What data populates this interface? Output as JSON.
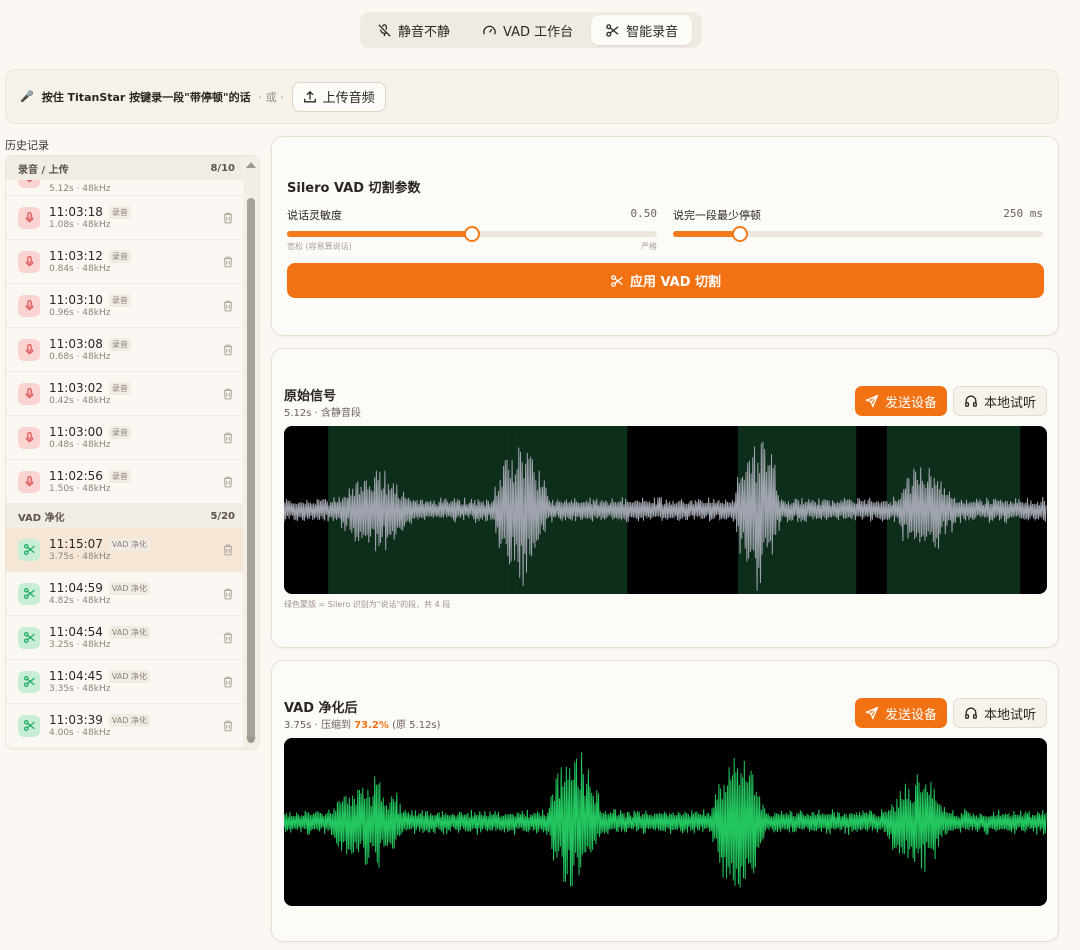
{
  "tabs": [
    {
      "label": "静音不静",
      "icon": "mic-off-icon"
    },
    {
      "label": "VAD 工作台",
      "icon": "gauge-icon"
    },
    {
      "label": "智能录音",
      "icon": "scissors-icon",
      "active": true
    }
  ],
  "hint": {
    "text": "按住 TitanStar 按键录一段\"带停顿\"的话",
    "or": "· 或 ·",
    "upload_label": "上传音频"
  },
  "history": {
    "title": "历史记录",
    "groups": [
      {
        "name": "录音 / 上传",
        "count": "8/10",
        "partial_sub": "5.12s · 48kHz",
        "items": [
          {
            "time": "11:03:18",
            "tag": "录音",
            "sub": "1.08s · 48kHz"
          },
          {
            "time": "11:03:12",
            "tag": "录音",
            "sub": "0.84s · 48kHz"
          },
          {
            "time": "11:03:10",
            "tag": "录音",
            "sub": "0.96s · 48kHz"
          },
          {
            "time": "11:03:08",
            "tag": "录音",
            "sub": "0.68s · 48kHz"
          },
          {
            "time": "11:03:02",
            "tag": "录音",
            "sub": "0.42s · 48kHz"
          },
          {
            "time": "11:03:00",
            "tag": "录音",
            "sub": "0.48s · 48kHz"
          },
          {
            "time": "11:02:56",
            "tag": "录音",
            "sub": "1.50s · 48kHz"
          }
        ]
      },
      {
        "name": "VAD 净化",
        "count": "5/20",
        "items": [
          {
            "time": "11:15:07",
            "tag": "VAD 净化",
            "sub": "3.75s · 48kHz",
            "selected": true
          },
          {
            "time": "11:04:59",
            "tag": "VAD 净化",
            "sub": "4.82s · 48kHz"
          },
          {
            "time": "11:04:54",
            "tag": "VAD 净化",
            "sub": "3.25s · 48kHz"
          },
          {
            "time": "11:04:45",
            "tag": "VAD 净化",
            "sub": "3.35s · 48kHz"
          },
          {
            "time": "11:03:39",
            "tag": "VAD 净化",
            "sub": "4.00s · 48kHz"
          }
        ]
      }
    ]
  },
  "params": {
    "title": "Silero VAD 切割参数",
    "sensitivity": {
      "label": "说话灵敏度",
      "value": "0.50",
      "level": 0.5,
      "left_end": "宽松 (容易算说话)",
      "right_end": "严格"
    },
    "min_pause": {
      "label": "说完一段最少停顿",
      "value": "250 ms",
      "level": 0.18
    },
    "apply_label": "应用 VAD 切割"
  },
  "original": {
    "title": "原始信号",
    "sub": "5.12s · 含静音段",
    "send_label": "发送设备",
    "listen_label": "本地试听",
    "caption": "绿色蒙版 = Silero 识别为\"说话\"的段，共 4 段"
  },
  "cleaned": {
    "title": "VAD 净化后",
    "sub_prefix": "3.75s · 压缩到 ",
    "pct": "73.2%",
    "sub_suffix": " (原 5.12s)",
    "send_label": "发送设备",
    "listen_label": "本地试听"
  },
  "colors": {
    "accent": "#f27213",
    "orig_wave": "#9fa3ad",
    "clean_wave": "#22c55e",
    "speech_mask": "#0d2e1a"
  }
}
